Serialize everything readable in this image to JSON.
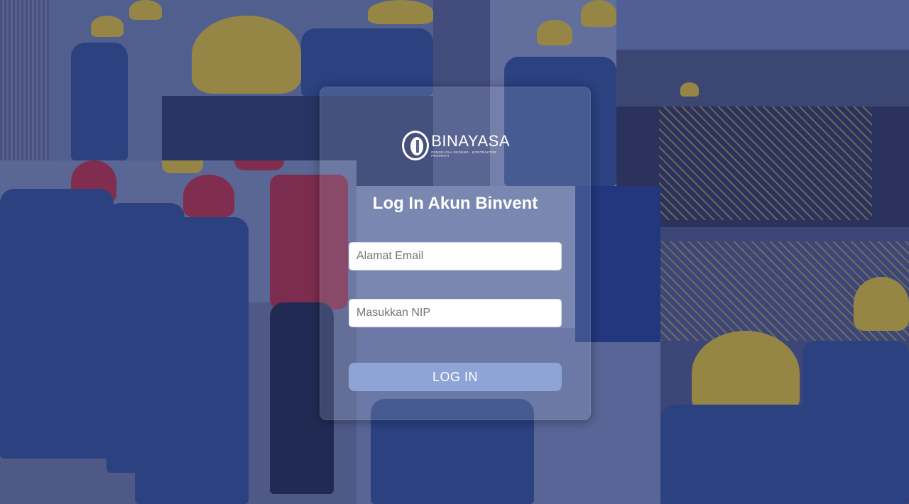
{
  "brand": {
    "name": "BINAYASA",
    "tagline": "PENGELOLA GEDUNG · KONTRAKTOR · PROPERTI",
    "logo_icon": "binayasa-logo-icon"
  },
  "login": {
    "title": "Log In Akun Binvent",
    "email_placeholder": "Alamat Email",
    "email_value": "",
    "nip_placeholder": "Masukkan NIP",
    "nip_value": "",
    "button_label": "LOG IN"
  },
  "colors": {
    "overlay": "#28346e",
    "button": "#8ea4d6",
    "text": "#ffffff"
  }
}
